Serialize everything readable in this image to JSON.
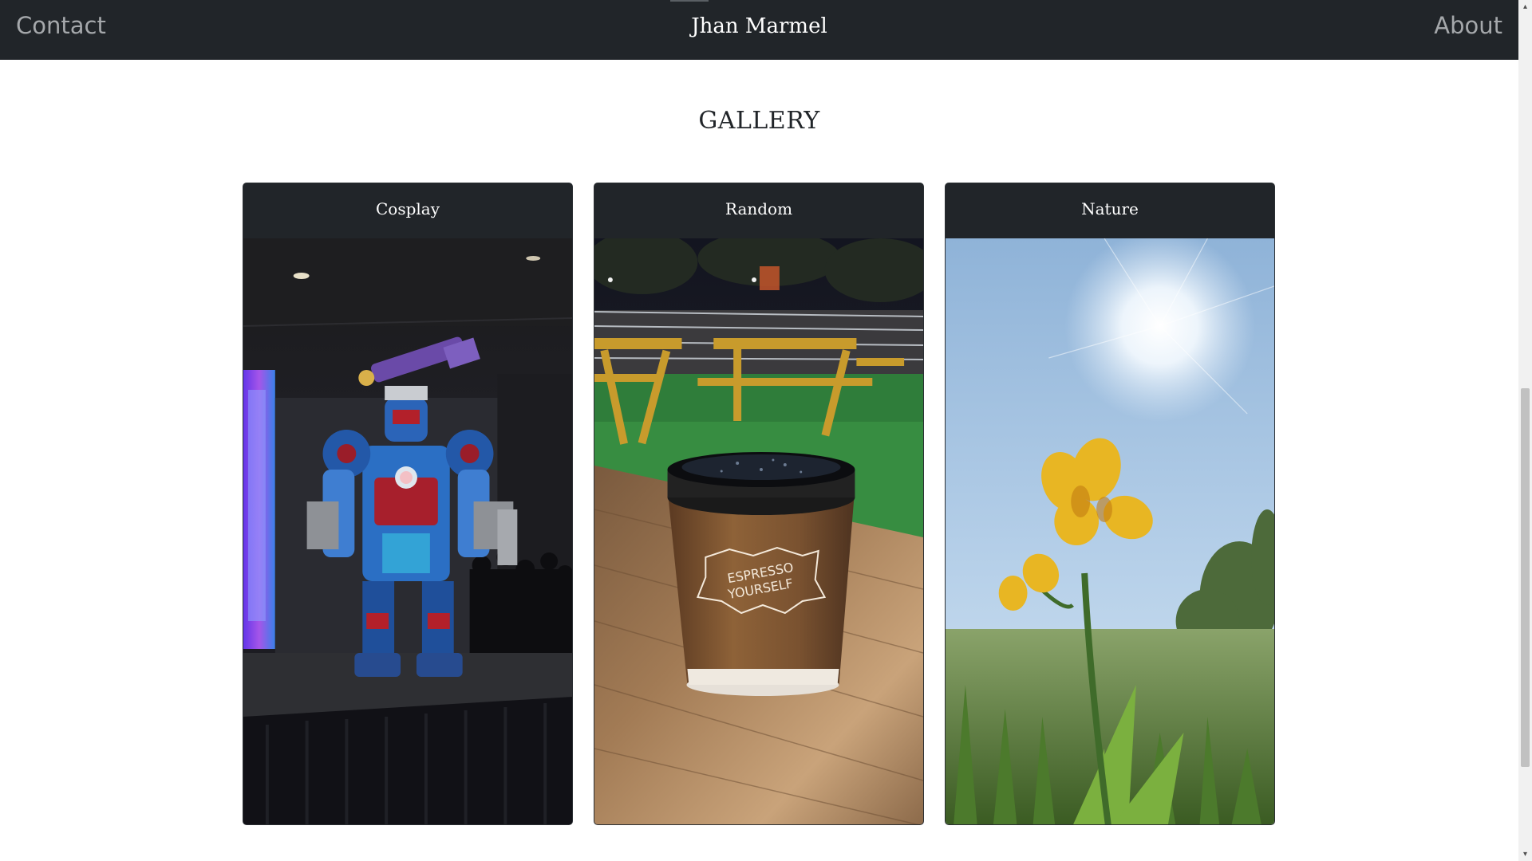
{
  "navbar": {
    "left_link": "Contact",
    "brand": "Jhan Marmel",
    "right_link": "About",
    "background": "#212529"
  },
  "main": {
    "title": "GALLERY",
    "cards": [
      {
        "label": "Cosplay",
        "image": "Cosplayer in a red, white and blue armored mech suit on a convention stage"
      },
      {
        "label": "Random",
        "image": "Paper coffee cup printed with ESPRESSO YOURSELF on a wooden table at night"
      },
      {
        "label": "Nature",
        "image": "Yellow iris flower against a sunny blue sky and green grass"
      }
    ]
  },
  "random_cup_text": [
    "ESPRESSO",
    "YOURSELF"
  ],
  "scrollbar": {
    "up_icon": "chevron-up-icon",
    "down_icon": "chevron-down-icon"
  }
}
